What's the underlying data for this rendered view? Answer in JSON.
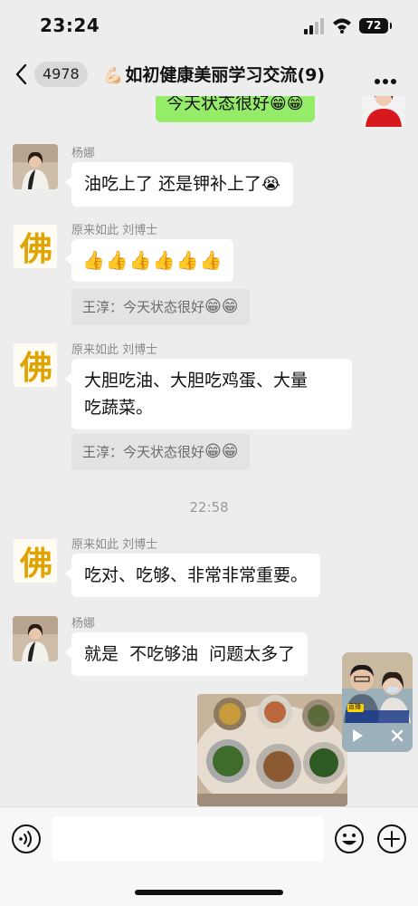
{
  "status_bar": {
    "time": "23:24",
    "battery": "72"
  },
  "header": {
    "unread_count": "4978",
    "title_emoji": "💪🏻",
    "title": "如初健康美丽学习交流",
    "member_count": "(9)"
  },
  "messages": [
    {
      "type": "outgoing",
      "text": "今天状态很好",
      "emoji": "😁😁"
    },
    {
      "type": "incoming",
      "sender": "杨娜",
      "avatar": "photo",
      "text": "油吃上了 还是钾补上了",
      "emoji": "😭"
    },
    {
      "type": "incoming",
      "sender": "原来如此 刘博士",
      "avatar": "logo",
      "text": "👍👍👍👍👍👍",
      "quote_text": "王淳：今天状态很好",
      "quote_emoji": "😁😁"
    },
    {
      "type": "incoming",
      "sender": "原来如此 刘博士",
      "avatar": "logo",
      "text_line1": "大胆吃油、大胆吃鸡蛋、大量",
      "text_line2": "吃蔬菜。",
      "quote_text": "王淳：今天状态很好",
      "quote_emoji": "😁😁"
    },
    {
      "type": "timestamp",
      "text": "22:58"
    },
    {
      "type": "incoming",
      "sender": "原来如此 刘博士",
      "avatar": "logo",
      "text": "吃对、吃够、非常非常重要。"
    },
    {
      "type": "incoming",
      "sender": "杨娜",
      "avatar": "photo",
      "text": "就是  不吃够油  问题太多了"
    },
    {
      "type": "outgoing-image",
      "image": "food-dishes-photo"
    }
  ],
  "pip": {
    "label": "直播"
  },
  "colors": {
    "background": "#ededed",
    "outgoing_bubble": "#95ec69",
    "incoming_bubble": "#ffffff",
    "quote_bg": "#e3e3e3",
    "input_bar": "#f7f7f7"
  },
  "icons": {
    "back": "chevron-left-icon",
    "more": "more-dots-icon",
    "voice": "voice-icon",
    "emoji": "smiley-icon",
    "plus": "plus-circle-icon",
    "pip_play": "play-icon",
    "pip_close": "close-icon"
  }
}
